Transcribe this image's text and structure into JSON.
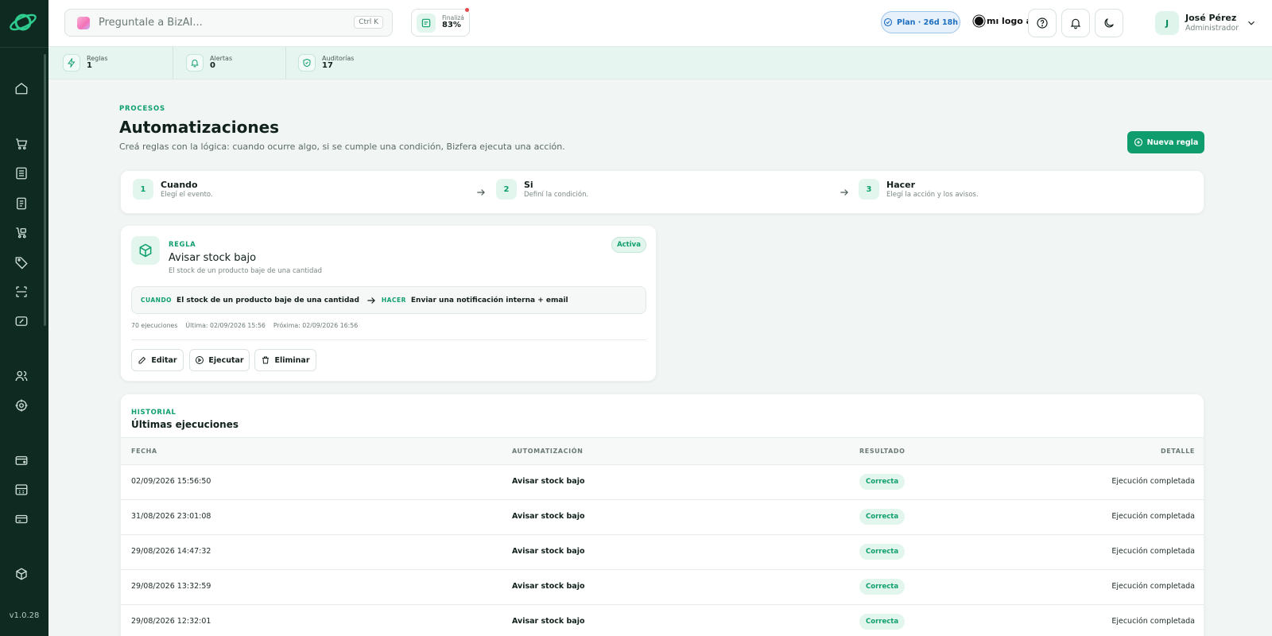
{
  "app": {
    "version": "v1.0.28"
  },
  "search": {
    "placeholder": "Preguntale a BizAI...",
    "shortcut": "Ctrl K"
  },
  "progress": {
    "label": "Finalizá",
    "value": "83%"
  },
  "plan": {
    "label": "Plan · 26d 18h"
  },
  "brand": {
    "label": "mı logo acá"
  },
  "user": {
    "initial": "J",
    "name": "José Pérez",
    "role": "Administrador"
  },
  "stats": [
    {
      "label": "Reglas",
      "value": "1",
      "icon": "bolt-icon"
    },
    {
      "label": "Alertas",
      "value": "0",
      "icon": "bell-icon"
    },
    {
      "label": "Auditorías",
      "value": "17",
      "icon": "shield-check-icon"
    }
  ],
  "page": {
    "eyebrow": "PROCESOS",
    "title": "Automatizaciones",
    "subtitle": "Creá reglas con la lógica: cuando ocurre algo, si se cumple una condición, Bizfera ejecuta una acción.",
    "new_rule_label": "Nueva regla"
  },
  "steps": [
    {
      "num": "1",
      "title": "Cuando",
      "sub": "Elegí el evento."
    },
    {
      "num": "2",
      "title": "Si",
      "sub": "Definí la condición."
    },
    {
      "num": "3",
      "title": "Hacer",
      "sub": "Elegí la acción y los avisos."
    }
  ],
  "rule": {
    "eyebrow": "REGLA",
    "title": "Avisar stock bajo",
    "description": "El stock de un producto baje de una cantidad",
    "status": "Activa",
    "when_tag": "CUANDO",
    "when_text": "El stock de un producto baje de una cantidad",
    "do_tag": "HACER",
    "do_text": "Enviar una notificación interna + email",
    "executions": "70 ejecuciones",
    "last": "Última: 02/09/2026 15:56",
    "next": "Próxima: 02/09/2026 16:56",
    "edit_label": "Editar",
    "run_label": "Ejecutar",
    "delete_label": "Eliminar"
  },
  "history": {
    "eyebrow": "HISTORIAL",
    "title": "Últimas ejecuciones",
    "columns": [
      "FECHA",
      "AUTOMATIZACIÓN",
      "RESULTADO",
      "DETALLE"
    ],
    "rows": [
      {
        "date": "02/09/2026 15:56:50",
        "automation": "Avisar stock bajo",
        "result": "Correcta",
        "detail": "Ejecución completada"
      },
      {
        "date": "31/08/2026 23:01:08",
        "automation": "Avisar stock bajo",
        "result": "Correcta",
        "detail": "Ejecución completada"
      },
      {
        "date": "29/08/2026 14:47:32",
        "automation": "Avisar stock bajo",
        "result": "Correcta",
        "detail": "Ejecución completada"
      },
      {
        "date": "29/08/2026 13:32:59",
        "automation": "Avisar stock bajo",
        "result": "Correcta",
        "detail": "Ejecución completada"
      },
      {
        "date": "29/08/2026 12:32:01",
        "automation": "Avisar stock bajo",
        "result": "Correcta",
        "detail": "Ejecución completada"
      }
    ]
  },
  "colors": {
    "accent": "#0f9d6e",
    "sidebar": "#0f2a21",
    "plan": "#1e6fbf"
  }
}
